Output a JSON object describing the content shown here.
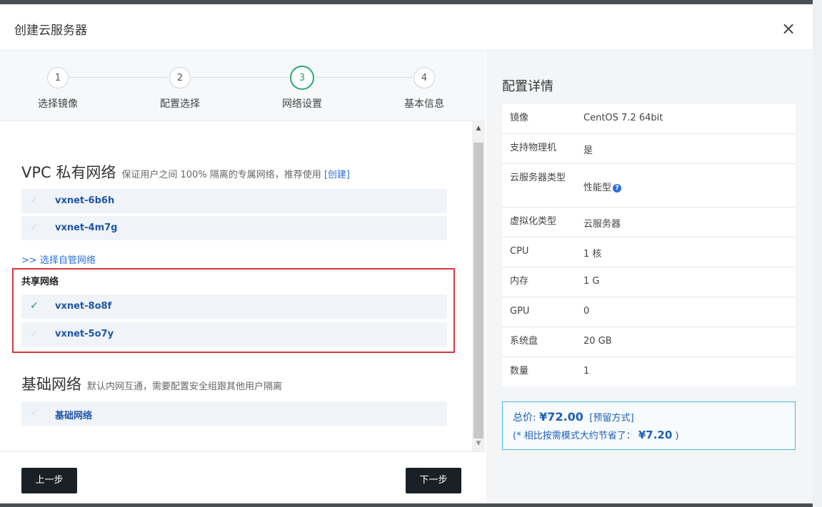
{
  "modal": {
    "title": "创建云服务器",
    "close_label": "×"
  },
  "steps": [
    {
      "number": "1",
      "label": "选择镜像"
    },
    {
      "number": "2",
      "label": "配置选择"
    },
    {
      "number": "3",
      "label": "网络设置",
      "active": true
    },
    {
      "number": "4",
      "label": "基本信息"
    }
  ],
  "vpc": {
    "title": "VPC 私有网络",
    "description": "保证用户之间 100% 隔离的专属网络，推荐使用",
    "create_link": "[创建]",
    "networks": [
      {
        "name": "vxnet-6b6h",
        "selected": false
      },
      {
        "name": "vxnet-4m7g",
        "selected": false
      }
    ],
    "manage_link": ">> 选择自管网络"
  },
  "shared": {
    "title": "共享网络",
    "networks": [
      {
        "name": "vxnet-8o8f",
        "selected": true
      },
      {
        "name": "vxnet-5o7y",
        "selected": false
      }
    ]
  },
  "basic": {
    "title": "基础网络",
    "description": "默认内网互通，需要配置安全组跟其他用户隔离",
    "networks": [
      {
        "name": "基础网络",
        "selected": false
      }
    ]
  },
  "check_glyph": "✓",
  "footer": {
    "prev_label": "上一步",
    "next_label": "下一步"
  },
  "details": {
    "title": "配置详情",
    "rows": [
      {
        "key": "镜像",
        "value": "CentOS 7.2 64bit"
      },
      {
        "key": "支持物理机",
        "value": "是"
      },
      {
        "key": "云服务器类型",
        "value": "性能型",
        "help_icon": "question-circle-icon"
      },
      {
        "key": "虚拟化类型",
        "value": "云服务器"
      },
      {
        "key": "CPU",
        "value": "1 核"
      },
      {
        "key": "内存",
        "value": "1 G"
      },
      {
        "key": "GPU",
        "value": "0"
      },
      {
        "key": "系统盘",
        "value": "20 GB"
      },
      {
        "key": "数量",
        "value": "1"
      }
    ]
  },
  "price": {
    "label": "总价:",
    "amount": "¥72.00",
    "method": "[预留方式]",
    "save_prefix": "(* 相比按需模式大约节省了：",
    "save_amount": "¥7.20",
    "save_suffix": ")"
  },
  "colors": {
    "accent_green": "#2aa871",
    "link_blue": "#2f6fd6",
    "highlight_red": "#d9363e",
    "button_dark": "#1b2027"
  }
}
